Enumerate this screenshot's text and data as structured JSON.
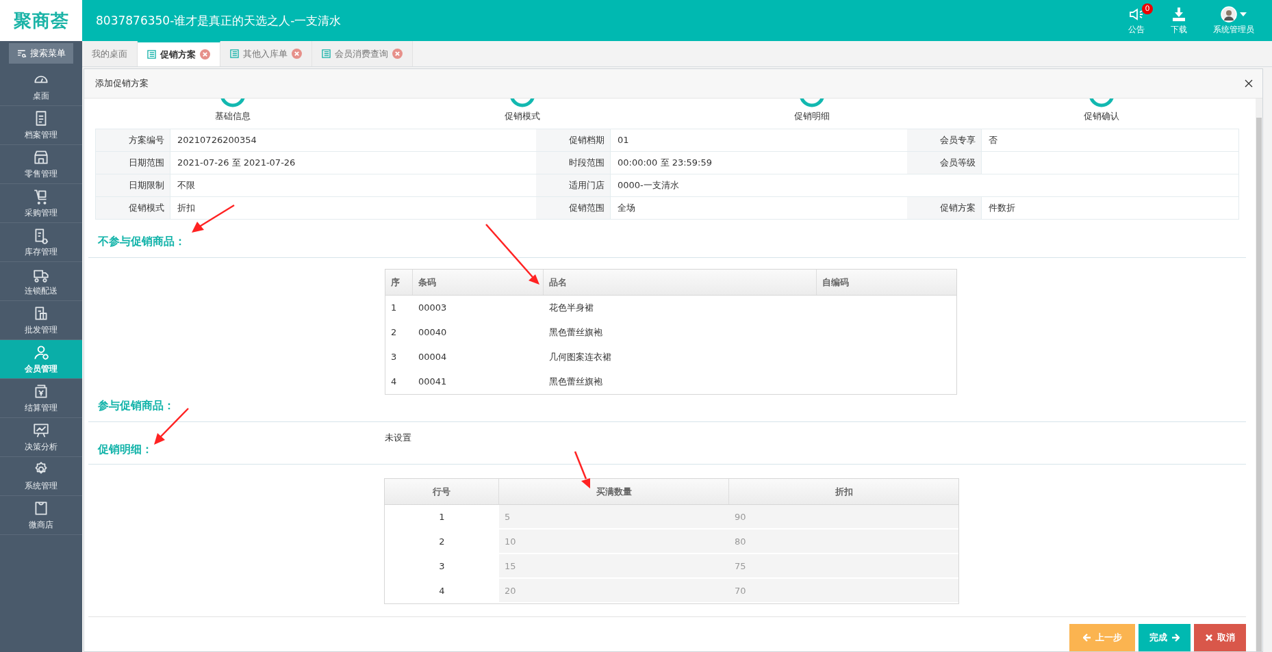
{
  "app": {
    "logo": "聚商荟",
    "title": "8037876350-谁才是真正的天选之人-一支清水"
  },
  "header_actions": [
    {
      "label": "公告",
      "kind": "notice",
      "badge": "0"
    },
    {
      "label": "下载",
      "kind": "download"
    },
    {
      "label": "系统管理员",
      "kind": "user"
    }
  ],
  "sidebar": {
    "search": "搜索菜单",
    "items": [
      {
        "label": "桌面",
        "selected": false
      },
      {
        "label": "档案管理",
        "selected": false
      },
      {
        "label": "零售管理",
        "selected": false
      },
      {
        "label": "采购管理",
        "selected": false
      },
      {
        "label": "库存管理",
        "selected": false
      },
      {
        "label": "连锁配送",
        "selected": false
      },
      {
        "label": "批发管理",
        "selected": false
      },
      {
        "label": "会员管理",
        "selected": true
      },
      {
        "label": "结算管理",
        "selected": false
      },
      {
        "label": "决策分析",
        "selected": false
      },
      {
        "label": "系统管理",
        "selected": false
      },
      {
        "label": "微商店",
        "selected": false
      }
    ]
  },
  "tabs": [
    {
      "label": "我的桌面",
      "selected": false,
      "closable": false
    },
    {
      "label": "促销方案",
      "selected": true,
      "closable": true
    },
    {
      "label": "其他入库单",
      "selected": false,
      "closable": true
    },
    {
      "label": "会员消费查询",
      "selected": false,
      "closable": true
    }
  ],
  "dialog": {
    "title": "添加促销方案",
    "steps": [
      "基础信息",
      "促销模式",
      "促销明细",
      "促销确认"
    ],
    "info_rows": [
      [
        {
          "label": "方案编号",
          "value": "20210726200354"
        },
        {
          "label": "促销档期",
          "value": "01"
        },
        {
          "label": "会员专享",
          "value": "否"
        }
      ],
      [
        {
          "label": "日期范围",
          "value": "2021-07-26 至 2021-07-26"
        },
        {
          "label": "时段范围",
          "value": "00:00:00 至 23:59:59"
        },
        {
          "label": "会员等级"
        }
      ],
      [
        {
          "label": "日期限制",
          "value": "不限"
        },
        {
          "label": "适用门店",
          "value": "0000-一支清水"
        }
      ],
      [
        {
          "label": "促销模式",
          "value": "折扣"
        },
        {
          "label": "促销范围",
          "value": "全场"
        },
        {
          "label": "促销方案",
          "value": "件数折"
        }
      ]
    ],
    "excluded_goods": {
      "heading": "不参与促销商品：",
      "columns": [
        "序",
        "条码",
        "品名",
        "自编码"
      ],
      "rows": [
        [
          "1",
          "00003",
          "花色半身裙"
        ],
        [
          "2",
          "00040",
          "黑色蕾丝旗袍"
        ],
        [
          "3",
          "00004",
          "几何图案连衣裙"
        ],
        [
          "4",
          "00041",
          "黑色蕾丝旗袍"
        ]
      ]
    },
    "included_goods": {
      "heading": "参与促销商品：",
      "empty_text": "未设置"
    },
    "details": {
      "heading": "促销明细：",
      "columns": [
        "行号",
        "买满数量",
        "折扣"
      ],
      "rows": [
        [
          "1",
          "5",
          "90"
        ],
        [
          "2",
          "10",
          "80"
        ],
        [
          "3",
          "15",
          "75"
        ],
        [
          "4",
          "20",
          "70"
        ]
      ]
    },
    "buttons": [
      {
        "label": "上一步",
        "kind": "prev"
      },
      {
        "label": "完成",
        "kind": "finish"
      },
      {
        "label": "取消",
        "kind": "cancel"
      }
    ]
  }
}
